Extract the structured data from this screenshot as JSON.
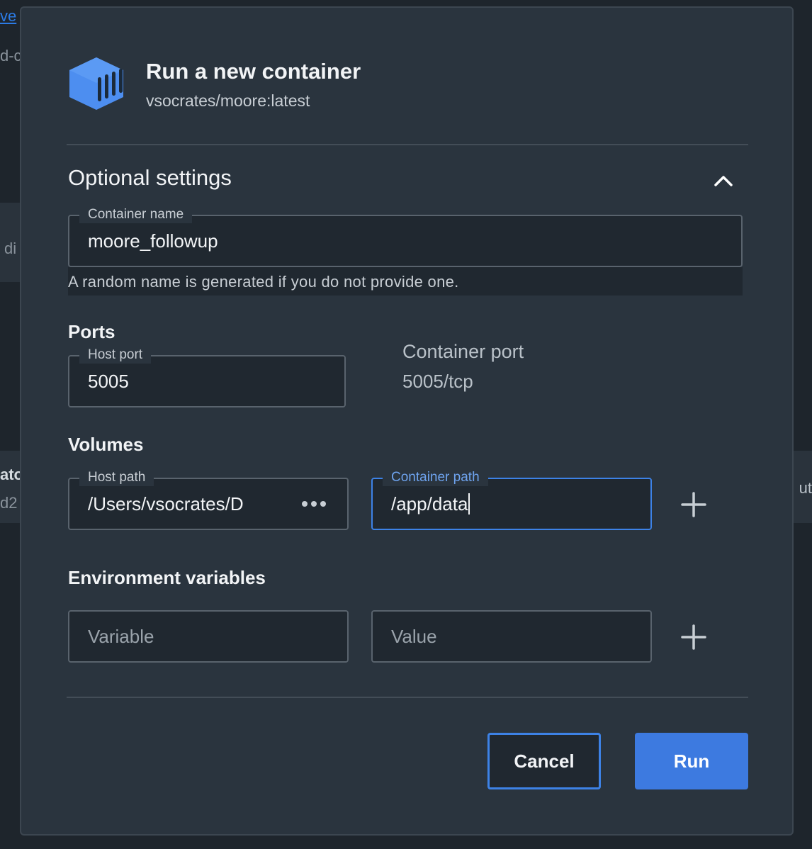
{
  "background": {
    "link_fragment": "ve",
    "frag1": "d-c",
    "frag2": "di",
    "frag3": "ato",
    "frag4": "d2",
    "frag5": "ut"
  },
  "modal": {
    "title": "Run a new container",
    "image": "vsocrates/moore:latest",
    "logo_icon": "docker-container-icon",
    "optional_settings": {
      "title": "Optional settings",
      "toggle_icon": "chevron-up-icon",
      "expanded": true
    },
    "container_name": {
      "label": "Container name",
      "value": "moore_followup",
      "helper": "A random name is generated if you do not provide one."
    },
    "ports": {
      "title": "Ports",
      "host_port_label": "Host port",
      "host_port_value": "5005",
      "container_port_label": "Container port",
      "container_port_value": "5005/tcp"
    },
    "volumes": {
      "title": "Volumes",
      "host_path_label": "Host path",
      "host_path_value": "/Users/vsocrates/D",
      "container_path_label": "Container path",
      "container_path_value": "/app/data",
      "browse_icon": "more-horizontal-icon",
      "add_icon": "plus-icon"
    },
    "env": {
      "title": "Environment variables",
      "variable_placeholder": "Variable",
      "value_placeholder": "Value",
      "add_icon": "plus-icon"
    },
    "buttons": {
      "cancel": "Cancel",
      "run": "Run"
    }
  },
  "colors": {
    "accent": "#3d7ae0",
    "modal_bg": "#2a343e",
    "input_bg": "#202830"
  }
}
